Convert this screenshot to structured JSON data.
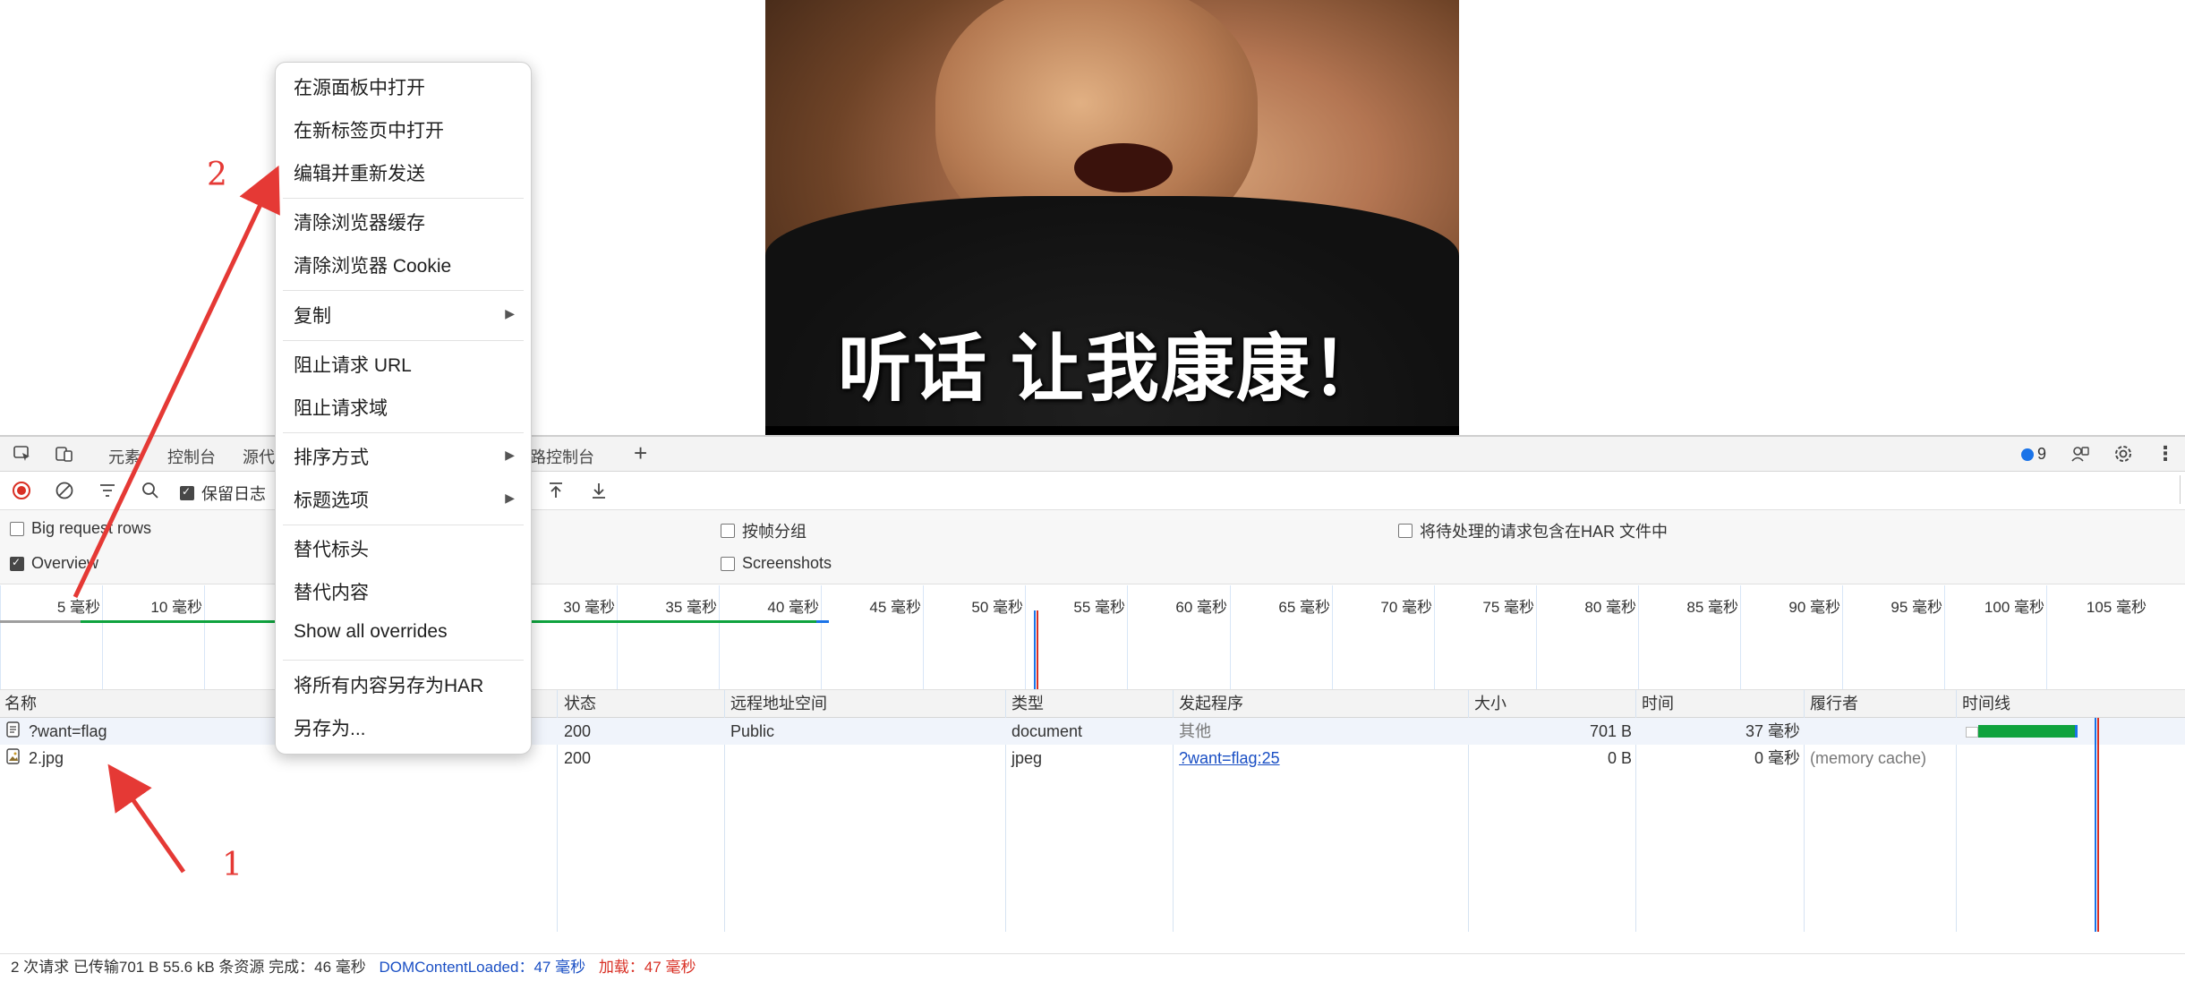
{
  "photo": {
    "caption": "听话 让我康康！"
  },
  "devtools": {
    "tabs": [
      "元素",
      "控制台",
      "源代",
      "路控制台"
    ],
    "issues_count": "9",
    "toolbar": {
      "preserve_log_label": "保留日志"
    },
    "settings": {
      "big_request_rows": "Big request rows",
      "overview": "Overview",
      "group_by_frame": "按帧分组",
      "screenshots": "Screenshots",
      "har_pending": "将待处理的请求包含在HAR 文件中"
    },
    "overview_ticks": [
      "5 毫秒",
      "10 毫秒",
      "15",
      "30 毫秒",
      "35 毫秒",
      "40 毫秒",
      "45 毫秒",
      "50 毫秒",
      "55 毫秒",
      "60 毫秒",
      "65 毫秒",
      "70 毫秒",
      "75 毫秒",
      "80 毫秒",
      "85 毫秒",
      "90 毫秒",
      "95 毫秒",
      "100 毫秒",
      "105 毫秒"
    ],
    "columns": [
      "名称",
      "状态",
      "远程地址空间",
      "类型",
      "发起程序",
      "大小",
      "时间",
      "履行者",
      "时间线"
    ],
    "rows": [
      {
        "name": "?want=flag",
        "status": "200",
        "remote": "Public",
        "type": "document",
        "initiator": "其他",
        "size": "701 B",
        "time": "37 毫秒",
        "fulfilled": ""
      },
      {
        "name": "2.jpg",
        "status": "200",
        "remote": "",
        "type": "jpeg",
        "initiator": "?want=flag:25",
        "size": "0 B",
        "time": "0 毫秒",
        "fulfilled": "(memory cache)"
      }
    ],
    "footer": {
      "summary": "2 次请求  已传输701 B  55.6 kB 条资源  完成：46 毫秒",
      "dcl": "DOMContentLoaded：47 毫秒",
      "load": "加载：47 毫秒"
    }
  },
  "context_menu": {
    "items": [
      "在源面板中打开",
      "在新标签页中打开",
      "编辑并重新发送",
      "清除浏览器缓存",
      "清除浏览器 Cookie",
      "复制",
      "阻止请求 URL",
      "阻止请求域",
      "排序方式",
      "标题选项",
      "替代标头",
      "替代内容",
      "Show all overrides",
      "将所有内容另存为HAR",
      "另存为..."
    ]
  },
  "annotations": {
    "one": "1",
    "two": "2"
  },
  "colors": {
    "accent_red": "#e53935",
    "timeline_green": "#0fa33e",
    "link_blue": "#1a4fc4"
  }
}
